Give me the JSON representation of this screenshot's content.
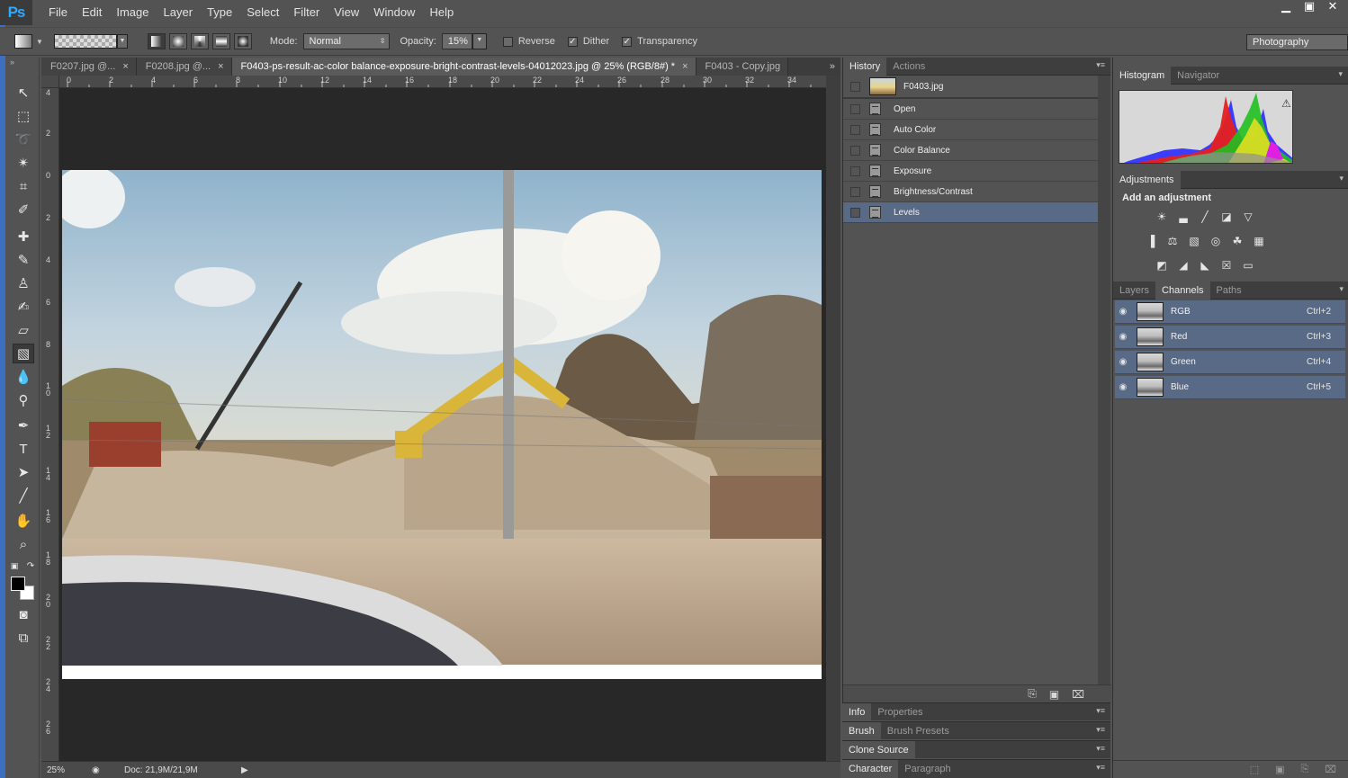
{
  "app": {
    "logo": "Ps",
    "menu": [
      "File",
      "Edit",
      "Image",
      "Layer",
      "Type",
      "Select",
      "Filter",
      "View",
      "Window",
      "Help"
    ],
    "window_controls": [
      "minimize-icon",
      "restore-icon",
      "close-icon"
    ]
  },
  "options": {
    "mode_label": "Mode:",
    "mode_value": "Normal",
    "opacity_label": "Opacity:",
    "opacity_value": "15%",
    "reverse_label": "Reverse",
    "reverse_checked": false,
    "dither_label": "Dither",
    "dither_checked": true,
    "transparency_label": "Transparency",
    "transparency_checked": true,
    "workspace": "Photography"
  },
  "tools": [
    "move-tool-icon",
    "marquee-tool-icon",
    "lasso-tool-icon",
    "magic-wand-icon",
    "crop-tool-icon",
    "eyedropper-icon",
    "healing-brush-icon",
    "brush-tool-icon",
    "clone-stamp-icon",
    "history-brush-icon",
    "eraser-icon",
    "gradient-tool-icon",
    "blur-tool-icon",
    "dodge-tool-icon",
    "pen-tool-icon",
    "type-tool-icon",
    "path-selection-icon",
    "line-tool-icon",
    "hand-tool-icon",
    "zoom-tool-icon"
  ],
  "colors": {
    "foreground": "#000000",
    "background": "#ffffff",
    "selection": "#586a86",
    "accent": "#31a8ff"
  },
  "doc_tabs": [
    {
      "label": "F0207.jpg @...",
      "active": false
    },
    {
      "label": "F0208.jpg @...",
      "active": false
    },
    {
      "label": "F0403-ps-result-ac-color balance-exposure-bright-contrast-levels-04012023.jpg @ 25% (RGB/8#) *",
      "active": true
    },
    {
      "label": "F0403 - Copy.jpg",
      "active": false
    }
  ],
  "rulers": {
    "top": [
      "0",
      "2",
      "4",
      "6",
      "8",
      "10",
      "12",
      "14",
      "16",
      "18",
      "20",
      "22",
      "24",
      "26",
      "28",
      "30",
      "32",
      "34"
    ],
    "left": [
      "4",
      "2",
      "0",
      "2",
      "4",
      "6",
      "8",
      "1\n0",
      "1\n2",
      "1\n4",
      "1\n6",
      "1\n8",
      "2\n0",
      "2\n2",
      "2\n4",
      "2\n6"
    ]
  },
  "status": {
    "zoom": "25%",
    "doc": "Doc: 21,9M/21,9M"
  },
  "history": {
    "tabs": [
      "History",
      "Actions"
    ],
    "snapshot": "F0403.jpg",
    "steps": [
      "Open",
      "Auto Color",
      "Color Balance",
      "Exposure",
      "Brightness/Contrast",
      "Levels"
    ],
    "selected_index": 5
  },
  "mini_panels": [
    {
      "tabs": [
        "Info",
        "Properties"
      ]
    },
    {
      "tabs": [
        "Brush",
        "Brush Presets"
      ]
    },
    {
      "tabs": [
        "Clone Source"
      ]
    },
    {
      "tabs": [
        "Character",
        "Paragraph"
      ]
    }
  ],
  "right": {
    "top_tabs": [
      "Histogram",
      "Navigator"
    ],
    "adjustments_tab": "Adjustments",
    "adjustments_title": "Add an adjustment",
    "layers_tabs": [
      "Layers",
      "Channels",
      "Paths"
    ],
    "channels": [
      {
        "name": "RGB",
        "shortcut": "Ctrl+2"
      },
      {
        "name": "Red",
        "shortcut": "Ctrl+3"
      },
      {
        "name": "Green",
        "shortcut": "Ctrl+4"
      },
      {
        "name": "Blue",
        "shortcut": "Ctrl+5"
      }
    ]
  }
}
